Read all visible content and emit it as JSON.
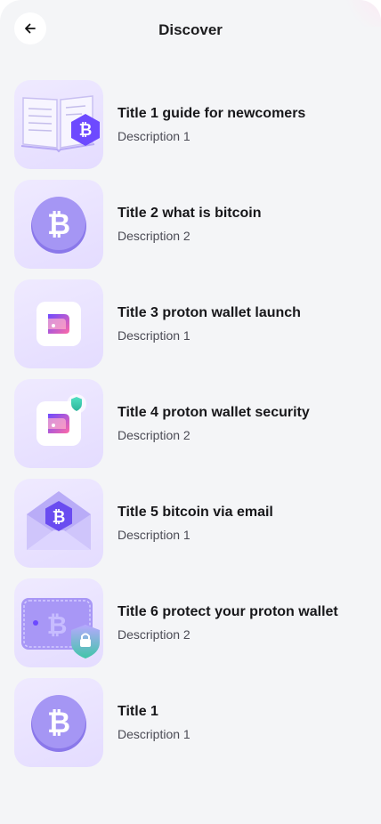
{
  "header": {
    "title": "Discover",
    "back_icon": "arrow-left-icon"
  },
  "articles": [
    {
      "title": "Title 1 guide for newcomers",
      "description": "Description 1",
      "icon": "book-bitcoin-icon"
    },
    {
      "title": "Title 2 what is bitcoin",
      "description": "Description 2",
      "icon": "bitcoin-coin-icon"
    },
    {
      "title": "Title 3 proton wallet launch",
      "description": "Description 1",
      "icon": "proton-wallet-app-icon"
    },
    {
      "title": "Title 4 proton wallet security",
      "description": "Description 2",
      "icon": "proton-wallet-shield-icon"
    },
    {
      "title": "Title 5 bitcoin via email",
      "description": "Description 1",
      "icon": "bitcoin-envelope-icon"
    },
    {
      "title": "Title 6 protect your proton wallet",
      "description": "Description 2",
      "icon": "wallet-lock-icon"
    },
    {
      "title": "Title 1",
      "description": "Description 1",
      "icon": "bitcoin-coin-icon"
    }
  ],
  "colors": {
    "background": "#f4f5f7",
    "thumb_bg": "#ebe5ff",
    "accent_purple": "#6d4aff",
    "coin_purple": "#8f7ef0"
  }
}
